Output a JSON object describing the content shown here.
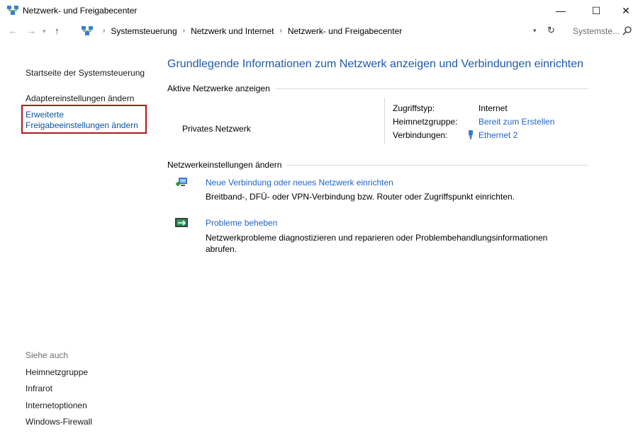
{
  "window": {
    "title": "Netzwerk- und Freigabecenter",
    "controls": {
      "minimize": "—",
      "maximize": "☐",
      "close": "✕"
    }
  },
  "addressbar": {
    "breadcrumbs": [
      "Systemsteuerung",
      "Netzwerk und Internet",
      "Netzwerk- und Freigabecenter"
    ],
    "search_placeholder": "Systemste...",
    "icons": {
      "back": "arrow-left-icon",
      "forward": "arrow-right-icon",
      "recent": "chevron-down-icon",
      "up": "arrow-up-icon",
      "refresh": "refresh-icon",
      "search": "search-icon"
    }
  },
  "leftpane": {
    "home_link": "Startseite der Systemsteuerung",
    "adapter_link": "Adaptereinstellungen ändern",
    "advanced_link_line1": "Erweiterte",
    "advanced_link_line2": "Freigabeeinstellungen ändern",
    "highlight_color": "#b3171d",
    "see_also": {
      "label": "Siehe auch",
      "items": [
        "Heimnetzgruppe",
        "Infrarot",
        "Internetoptionen",
        "Windows-Firewall"
      ]
    }
  },
  "main": {
    "heading": "Grundlegende Informationen zum Netzwerk anzeigen und Verbindungen einrichten",
    "active_networks": {
      "section_label": "Aktive Netzwerke anzeigen",
      "network_name": "Privates Netzwerk",
      "access_type_label": "Zugriffstyp:",
      "access_type_value": "Internet",
      "homegroup_label": "Heimnetzgruppe:",
      "homegroup_value": "Bereit zum Erstellen",
      "connections_label": "Verbindungen:",
      "connections_value": "Ethernet 2"
    },
    "change_settings": {
      "section_label": "Netzwerkeinstellungen ändern",
      "tasks": [
        {
          "title": "Neue Verbindung oder neues Netzwerk einrichten",
          "description": "Breitband-, DFÜ- oder VPN-Verbindung bzw. Router oder Zugriffspunkt einrichten.",
          "icon": "new-connection-icon"
        },
        {
          "title": "Probleme beheben",
          "description": "Netzwerkprobleme diagnostizieren und reparieren oder Problembehandlungsinformationen abrufen.",
          "icon": "troubleshoot-icon"
        }
      ]
    },
    "colors": {
      "link": "#1e66c7",
      "heading": "#1e5aa8"
    }
  }
}
